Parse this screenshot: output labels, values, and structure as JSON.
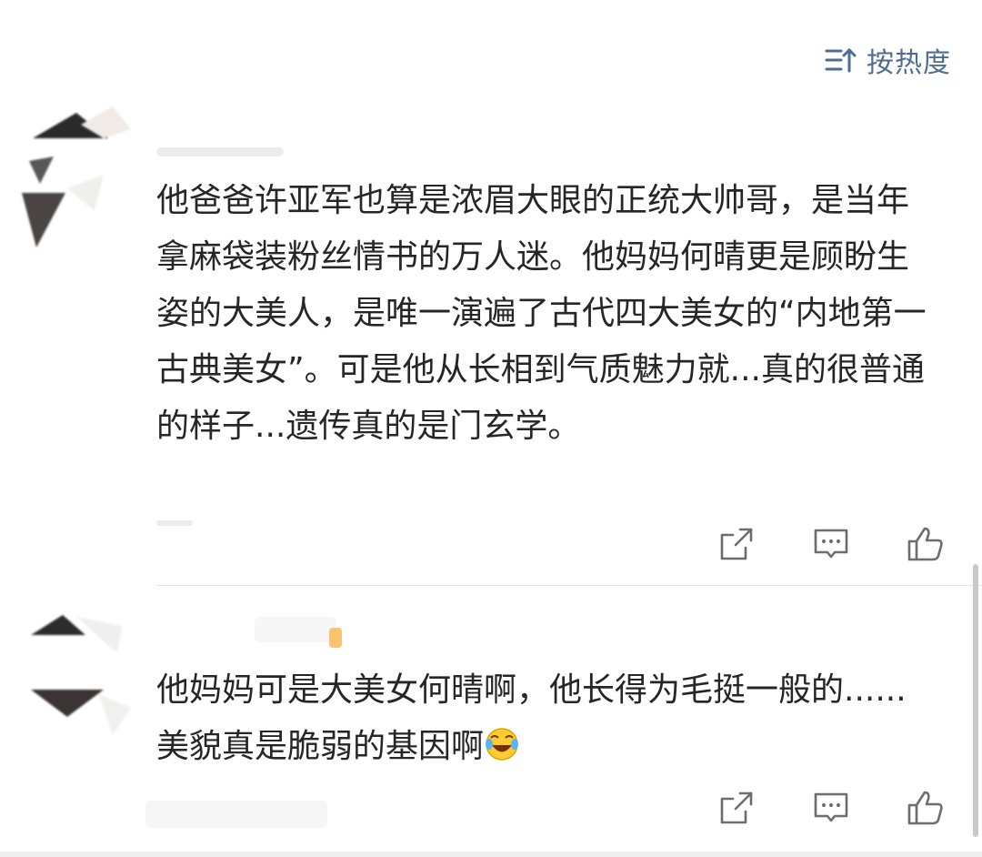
{
  "sort": {
    "label": "按热度",
    "icon": "sort-icon"
  },
  "comments": [
    {
      "text_before_emoji": "他爸爸许亚军也算是浓眉大眼的正统大帅哥，是当年拿麻袋装粉丝情书的万人迷。他妈妈何晴更是顾盼生姿的大美人，是唯一演遍了古代四大美女的“内地第一古典美女”。可是他从长相到气质魅力就...真的很普通的样子...遗传真的是门玄学。",
      "emoji": "",
      "actions": [
        "share-icon",
        "comment-icon",
        "like-icon"
      ]
    },
    {
      "text_before_emoji": "他妈妈可是大美女何晴啊，他长得为毛挺一般的......美貌真是脆弱的基因啊",
      "emoji": "laugh-cry-emoji",
      "actions": [
        "share-icon",
        "comment-icon",
        "like-icon"
      ]
    }
  ],
  "colors": {
    "accent": "#4e6e90",
    "text": "#262626",
    "icon": "#6d6d6d"
  }
}
